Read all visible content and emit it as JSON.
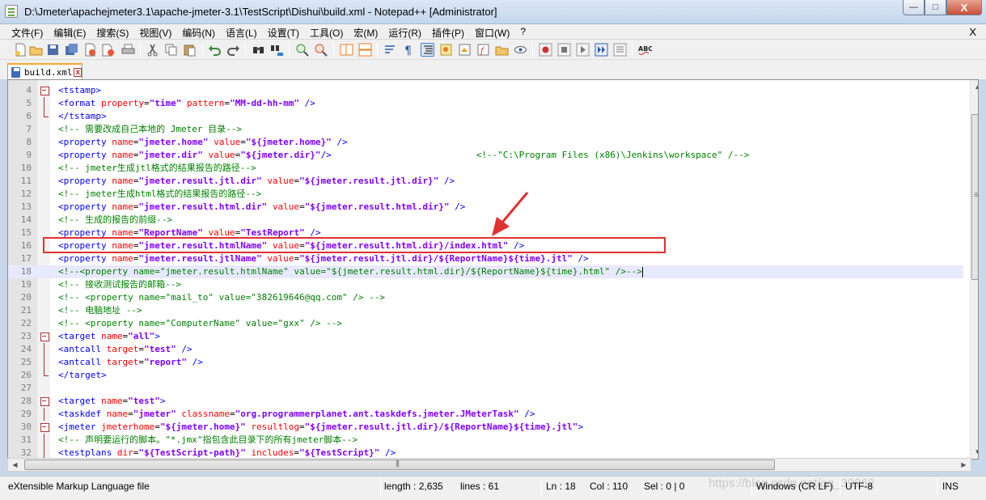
{
  "window": {
    "title": "D:\\Jmeter\\apachejmeter3.1\\apache-jmeter-3.1\\TestScript\\Dishui\\build.xml - Notepad++ [Administrator]",
    "min_glyph": "—",
    "max_glyph": "□",
    "close_glyph": "X"
  },
  "menu": {
    "items": [
      "文件(F)",
      "编辑(E)",
      "搜索(S)",
      "视图(V)",
      "编码(N)",
      "语言(L)",
      "设置(T)",
      "工具(O)",
      "宏(M)",
      "运行(R)",
      "插件(P)",
      "窗口(W)",
      "?"
    ],
    "close": "X"
  },
  "toolbar": {
    "buttons": [
      "new-file-icon",
      "open-file-icon",
      "save-icon",
      "save-all-icon",
      "close-icon",
      "close-all-icon",
      "print-icon",
      "cut-icon",
      "copy-icon",
      "paste-icon",
      "undo-icon",
      "redo-icon",
      "find-icon",
      "replace-icon",
      "zoom-in-icon",
      "zoom-out-icon",
      "sync-vertical-icon",
      "sync-horizontal-icon",
      "word-wrap-icon",
      "show-all-chars-icon",
      "indent-guide-icon",
      "udl-icon",
      "doc-map-icon",
      "function-list-icon",
      "folder-workspace-icon",
      "monitor-icon",
      "record-macro-icon",
      "stop-record-icon",
      "play-macro-icon",
      "run-macro-multiple-icon",
      "save-macro-icon",
      "spellcheck-icon"
    ]
  },
  "tab": {
    "label": "build.xml",
    "close_glyph": "x"
  },
  "editor": {
    "lines": [
      {
        "n": "4",
        "fold": "box",
        "segs": [
          [
            "t",
            "<tstamp>"
          ]
        ]
      },
      {
        "n": "5",
        "fold": "vline",
        "segs": [
          [
            "t",
            "<format "
          ],
          [
            "a",
            "property"
          ],
          [
            "p",
            "="
          ],
          [
            "v",
            "\"time\""
          ],
          [
            "p",
            " "
          ],
          [
            "a",
            "pattern"
          ],
          [
            "p",
            "="
          ],
          [
            "v",
            "\"MM-dd-hh-mm\""
          ],
          [
            "p",
            " "
          ],
          [
            "t",
            "/>"
          ]
        ]
      },
      {
        "n": "6",
        "fold": "end",
        "segs": [
          [
            "t",
            "</tstamp>"
          ]
        ]
      },
      {
        "n": "7",
        "fold": "",
        "segs": [
          [
            "c",
            "<!-- 需要改成自己本地的 Jmeter 目录-->"
          ]
        ]
      },
      {
        "n": "8",
        "fold": "",
        "segs": [
          [
            "t",
            "<property "
          ],
          [
            "a",
            "name"
          ],
          [
            "p",
            "="
          ],
          [
            "v",
            "\"jmeter.home\""
          ],
          [
            "p",
            " "
          ],
          [
            "a",
            "value"
          ],
          [
            "p",
            "="
          ],
          [
            "v",
            "\"${jmeter.home}\""
          ],
          [
            "p",
            " "
          ],
          [
            "t",
            "/>"
          ]
        ]
      },
      {
        "n": "9",
        "fold": "",
        "segs": [
          [
            "t",
            "<property "
          ],
          [
            "a",
            "name"
          ],
          [
            "p",
            "="
          ],
          [
            "v",
            "\"jmeter.dir\""
          ],
          [
            "p",
            " "
          ],
          [
            "a",
            "value"
          ],
          [
            "p",
            "="
          ],
          [
            "v",
            "\"${jmeter.dir}\""
          ],
          [
            "t",
            "/>"
          ],
          [
            "p",
            "                           "
          ],
          [
            "c",
            "<!--\"C:\\Program Files (x86)\\Jenkins\\workspace\" /-->"
          ]
        ]
      },
      {
        "n": "10",
        "fold": "",
        "segs": [
          [
            "c",
            "<!-- jmeter生成jtl格式的结果报告的路径-->"
          ]
        ]
      },
      {
        "n": "11",
        "fold": "",
        "segs": [
          [
            "t",
            "<property "
          ],
          [
            "a",
            "name"
          ],
          [
            "p",
            "="
          ],
          [
            "v",
            "\"jmeter.result.jtl.dir\""
          ],
          [
            "p",
            " "
          ],
          [
            "a",
            "value"
          ],
          [
            "p",
            "="
          ],
          [
            "v",
            "\"${jmeter.result.jtl.dir}\""
          ],
          [
            "p",
            " "
          ],
          [
            "t",
            "/>"
          ]
        ]
      },
      {
        "n": "12",
        "fold": "",
        "segs": [
          [
            "c",
            "<!-- jmeter生成html格式的结果报告的路径-->"
          ]
        ]
      },
      {
        "n": "13",
        "fold": "",
        "segs": [
          [
            "t",
            "<property "
          ],
          [
            "a",
            "name"
          ],
          [
            "p",
            "="
          ],
          [
            "v",
            "\"jmeter.result.html.dir\""
          ],
          [
            "p",
            " "
          ],
          [
            "a",
            "value"
          ],
          [
            "p",
            "="
          ],
          [
            "v",
            "\"${jmeter.result.html.dir}\""
          ],
          [
            "p",
            " "
          ],
          [
            "t",
            "/>"
          ]
        ]
      },
      {
        "n": "14",
        "fold": "",
        "segs": [
          [
            "c",
            "<!-- 生成的报告的前缀-->"
          ]
        ]
      },
      {
        "n": "15",
        "fold": "",
        "segs": [
          [
            "t",
            "<property "
          ],
          [
            "a",
            "name"
          ],
          [
            "p",
            "="
          ],
          [
            "v",
            "\"ReportName\""
          ],
          [
            "p",
            " "
          ],
          [
            "a",
            "value"
          ],
          [
            "p",
            "="
          ],
          [
            "v",
            "\"TestReport\""
          ],
          [
            "p",
            " "
          ],
          [
            "t",
            "/>"
          ]
        ]
      },
      {
        "n": "16",
        "fold": "",
        "segs": [
          [
            "t",
            "<property "
          ],
          [
            "a",
            "name"
          ],
          [
            "p",
            "="
          ],
          [
            "v",
            "\"jmeter.result.htmlName\""
          ],
          [
            "p",
            " "
          ],
          [
            "a",
            "value"
          ],
          [
            "p",
            "="
          ],
          [
            "v",
            "\"${jmeter.result.html.dir}/index.html\""
          ],
          [
            "p",
            " "
          ],
          [
            "t",
            "/>"
          ]
        ]
      },
      {
        "n": "17",
        "fold": "",
        "segs": [
          [
            "t",
            "<property "
          ],
          [
            "a",
            "name"
          ],
          [
            "p",
            "="
          ],
          [
            "v",
            "\"jmeter.result.jtlName\""
          ],
          [
            "p",
            " "
          ],
          [
            "a",
            "value"
          ],
          [
            "p",
            "="
          ],
          [
            "v",
            "\"${jmeter.result.jtl.dir}/${ReportName}${time}.jtl\""
          ],
          [
            "p",
            " "
          ],
          [
            "t",
            "/>"
          ]
        ]
      },
      {
        "n": "18",
        "fold": "",
        "current": true,
        "segs": [
          [
            "c",
            "<!--<property name=\"jmeter.result.htmlName\" value=\"${jmeter.result.html.dir}/${ReportName}${time}.html\" />-->"
          ]
        ]
      },
      {
        "n": "19",
        "fold": "",
        "segs": [
          [
            "c",
            "<!-- 接收测试报告的邮箱-->"
          ]
        ]
      },
      {
        "n": "20",
        "fold": "",
        "segs": [
          [
            "c",
            "<!-- <property name=\"mail_to\" value=\"382619646@qq.com\" /> -->"
          ]
        ]
      },
      {
        "n": "21",
        "fold": "",
        "segs": [
          [
            "c",
            "<!-- 电脑地址 -->"
          ]
        ]
      },
      {
        "n": "22",
        "fold": "",
        "segs": [
          [
            "c",
            "<!-- <property name=\"ComputerName\" value=\"gxx\" /> -->"
          ]
        ]
      },
      {
        "n": "23",
        "fold": "box",
        "segs": [
          [
            "t",
            "<target "
          ],
          [
            "a",
            "name"
          ],
          [
            "p",
            "="
          ],
          [
            "v",
            "\"all\""
          ],
          [
            "t",
            ">"
          ]
        ]
      },
      {
        "n": "24",
        "fold": "vline",
        "segs": [
          [
            "t",
            "<antcall "
          ],
          [
            "a",
            "target"
          ],
          [
            "p",
            "="
          ],
          [
            "v",
            "\"test\""
          ],
          [
            "p",
            " "
          ],
          [
            "t",
            "/>"
          ]
        ]
      },
      {
        "n": "25",
        "fold": "vline",
        "segs": [
          [
            "t",
            "<antcall "
          ],
          [
            "a",
            "target"
          ],
          [
            "p",
            "="
          ],
          [
            "v",
            "\"report\""
          ],
          [
            "p",
            " "
          ],
          [
            "t",
            "/>"
          ]
        ]
      },
      {
        "n": "26",
        "fold": "end",
        "segs": [
          [
            "t",
            "</target>"
          ]
        ]
      },
      {
        "n": "27",
        "fold": "",
        "segs": []
      },
      {
        "n": "28",
        "fold": "box",
        "segs": [
          [
            "t",
            "<target "
          ],
          [
            "a",
            "name"
          ],
          [
            "p",
            "="
          ],
          [
            "v",
            "\"test\""
          ],
          [
            "t",
            ">"
          ]
        ]
      },
      {
        "n": "29",
        "fold": "vline",
        "segs": [
          [
            "t",
            "<taskdef "
          ],
          [
            "a",
            "name"
          ],
          [
            "p",
            "="
          ],
          [
            "v",
            "\"jmeter\""
          ],
          [
            "p",
            " "
          ],
          [
            "a",
            "classname"
          ],
          [
            "p",
            "="
          ],
          [
            "v",
            "\"org.programmerplanet.ant.taskdefs.jmeter.JMeterTask\""
          ],
          [
            "p",
            " "
          ],
          [
            "t",
            "/>"
          ]
        ]
      },
      {
        "n": "30",
        "fold": "box",
        "segs": [
          [
            "t",
            "<jmeter "
          ],
          [
            "a",
            "jmeterhome"
          ],
          [
            "p",
            "="
          ],
          [
            "v",
            "\"${jmeter.home}\""
          ],
          [
            "p",
            " "
          ],
          [
            "a",
            "resultlog"
          ],
          [
            "p",
            "="
          ],
          [
            "v",
            "\"${jmeter.result.jtl.dir}/${ReportName}${time}.jtl\""
          ],
          [
            "t",
            ">"
          ]
        ]
      },
      {
        "n": "31",
        "fold": "vline",
        "segs": [
          [
            "c",
            "<!-- 声明要运行的脚本。\"*.jmx\"指包含此目录下的所有jmeter脚本-->"
          ]
        ]
      },
      {
        "n": "32",
        "fold": "vline",
        "segs": [
          [
            "t",
            "<testplans "
          ],
          [
            "a",
            "dir"
          ],
          [
            "p",
            "="
          ],
          [
            "v",
            "\"${TestScript-path}\""
          ],
          [
            "p",
            " "
          ],
          [
            "a",
            "includes"
          ],
          [
            "p",
            "="
          ],
          [
            "v",
            "\"${TestScript}\""
          ],
          [
            "p",
            " "
          ],
          [
            "t",
            "/>"
          ]
        ]
      }
    ]
  },
  "statusbar": {
    "filetype": "eXtensible Markup Language file",
    "length": "length : 2,635",
    "lines": "lines : 61",
    "ln": "Ln : 18",
    "col": "Col : 110",
    "sel": "Sel : 0 | 0",
    "eol": "Windows (CR LF)",
    "encoding": "UTF-8",
    "mode": "INS",
    "watermark": "https://blog.csdn.net/qq_39262"
  },
  "colors": {
    "tag": "#0000ff",
    "attribute": "#ff0000",
    "value": "#8000ff",
    "comment": "#008000",
    "highlight_box": "#e03030",
    "current_line": "#e8e8ff"
  }
}
